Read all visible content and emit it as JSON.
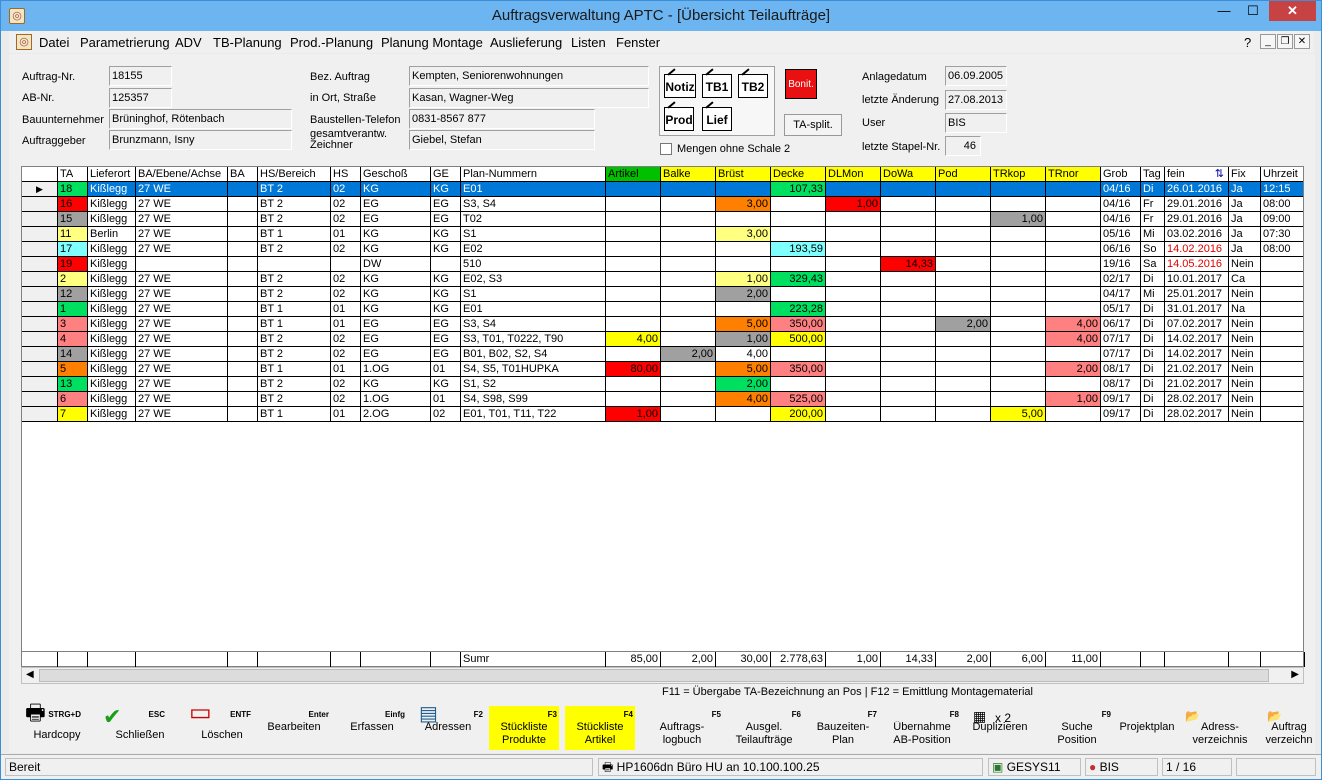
{
  "window": {
    "title": "Auftragsverwaltung APTC - [Übersicht Teilaufträge]"
  },
  "menu": [
    "Datei",
    "Parametrierung",
    "ADV",
    "TB-Planung",
    "Prod.-Planung",
    "Planung Montage",
    "Auslieferung",
    "Listen",
    "Fenster"
  ],
  "menu_help": "?",
  "form": {
    "auftrag_nr_label": "Auftrag-Nr.",
    "auftrag_nr": "18155",
    "ab_nr_label": "AB-Nr.",
    "ab_nr": "125357",
    "bauunternehmer_label": "Bauunternehmer",
    "bauunternehmer": "Brüninghof, Rötenbach",
    "auftraggeber_label": "Auftraggeber",
    "auftraggeber": "Brunzmann, Isny",
    "bez_auftrag_label": "Bez. Auftrag",
    "bez_auftrag": "Kempten, Seniorenwohnungen",
    "ort_strasse_label": "in Ort, Straße",
    "ort_strasse": "Kasan, Wagner-Weg",
    "baustellen_tel_label": "Baustellen-Telefon",
    "baustellen_tel": "0831-8567 877",
    "zeichner_label": "gesamtverantw. Zeichner",
    "zeichner": "Giebel, Stefan",
    "anlagedatum_label": "Anlagedatum",
    "anlagedatum": "06.09.2005",
    "letzte_aenderung_label": "letzte Änderung",
    "letzte_aenderung": "27.08.2013",
    "user_label": "User",
    "user": "BIS",
    "stapel_label": "letzte Stapel-Nr.",
    "stapel": "46"
  },
  "doc_buttons": [
    "Notiz",
    "TB1",
    "TB2",
    "Prod",
    "Lief"
  ],
  "bonit_label": "Bonit.",
  "tasplit_label": "TA-split.",
  "mengen_label": "Mengen ohne Schale 2",
  "colors": {
    "yellow": "#ffff00",
    "orange": "#ff8000",
    "green": "#00e060",
    "cyan": "#80ffff",
    "red": "#ff0000",
    "gray": "#a0a0a0",
    "pink": "#ff8080",
    "lightyellow": "#ffff80",
    "select": "#0078d7"
  },
  "columns": [
    "TA",
    "Lieferort",
    "BA/Ebene/Achse",
    "BA",
    "HS/Bereich",
    "HS",
    "Geschoß",
    "GE",
    "Plan-Nummern",
    "Artikel",
    "Balke",
    "Brüst",
    "Decke",
    "DLMon",
    "DoWa",
    "Pod",
    "TRkop",
    "TRnor",
    "Grob",
    "Tag",
    "fein",
    "Fix",
    "Uhrzeit"
  ],
  "rows": [
    {
      "ta": "18",
      "lieferort": "Kißlegg",
      "ba_ebene": "27 WE",
      "ba": "",
      "hs_bereich": "BT 2",
      "hs": "02",
      "geschoss": "KG",
      "ge": "KG",
      "plan": "E01",
      "artikel": "",
      "balke": "",
      "bruest": "",
      "decke": "107,33",
      "dlmon": "",
      "dowa": "",
      "pod": "",
      "trkop": "",
      "trnor": "",
      "grob": "04/16",
      "tag": "Di",
      "fein": "26.01.2016",
      "fix": "Ja",
      "uhrzeit": "12:15",
      "tac": "green",
      "selected": true
    },
    {
      "ta": "16",
      "lieferort": "Kißlegg",
      "ba_ebene": "27 WE",
      "ba": "",
      "hs_bereich": "BT 2",
      "hs": "02",
      "geschoss": "EG",
      "ge": "EG",
      "plan": "S3, S4",
      "artikel": "",
      "balke": "",
      "bruest": "3,00",
      "decke": "",
      "dlmon": "1,00",
      "dowa": "",
      "pod": "",
      "trkop": "",
      "trnor": "",
      "grob": "04/16",
      "tag": "Fr",
      "fein": "29.01.2016",
      "fix": "Ja",
      "uhrzeit": "08:00",
      "tac": "red"
    },
    {
      "ta": "15",
      "lieferort": "Kißlegg",
      "ba_ebene": "27 WE",
      "ba": "",
      "hs_bereich": "BT 2",
      "hs": "02",
      "geschoss": "EG",
      "ge": "EG",
      "plan": "T02",
      "artikel": "",
      "balke": "",
      "bruest": "",
      "decke": "",
      "dlmon": "",
      "dowa": "",
      "pod": "",
      "trkop": "1,00",
      "trnor": "",
      "grob": "04/16",
      "tag": "Fr",
      "fein": "29.01.2016",
      "fix": "Ja",
      "uhrzeit": "09:00",
      "tac": "gray"
    },
    {
      "ta": "11",
      "lieferort": "Berlin",
      "ba_ebene": "27 WE",
      "ba": "",
      "hs_bereich": "BT 1",
      "hs": "01",
      "geschoss": "KG",
      "ge": "KG",
      "plan": "S1",
      "artikel": "",
      "balke": "",
      "bruest": "3,00",
      "decke": "",
      "dlmon": "",
      "dowa": "",
      "pod": "",
      "trkop": "",
      "trnor": "",
      "grob": "05/16",
      "tag": "Mi",
      "fein": "03.02.2016",
      "fix": "Ja",
      "uhrzeit": "07:30",
      "tac": "lightyellow"
    },
    {
      "ta": "17",
      "lieferort": "Kißlegg",
      "ba_ebene": "27 WE",
      "ba": "",
      "hs_bereich": "BT 2",
      "hs": "02",
      "geschoss": "KG",
      "ge": "KG",
      "plan": "E02",
      "artikel": "",
      "balke": "",
      "bruest": "",
      "decke": "193,59",
      "dlmon": "",
      "dowa": "",
      "pod": "",
      "trkop": "",
      "trnor": "",
      "grob": "06/16",
      "tag": "So",
      "fein": "14.02.2016",
      "fix": "Ja",
      "uhrzeit": "08:00",
      "tac": "cyan",
      "fein_red": true
    },
    {
      "ta": "19",
      "lieferort": "Kißlegg",
      "ba_ebene": "",
      "ba": "",
      "hs_bereich": "",
      "hs": "",
      "geschoss": "DW",
      "ge": "",
      "plan": "510",
      "artikel": "",
      "balke": "",
      "bruest": "",
      "decke": "",
      "dlmon": "",
      "dowa": "14,33",
      "pod": "",
      "trkop": "",
      "trnor": "",
      "grob": "19/16",
      "tag": "Sa",
      "fein": "14.05.2016",
      "fix": "Nein",
      "uhrzeit": "",
      "tac": "red",
      "fein_red": true
    },
    {
      "ta": "2",
      "lieferort": "Kißlegg",
      "ba_ebene": "27 WE",
      "ba": "",
      "hs_bereich": "BT 2",
      "hs": "02",
      "geschoss": "KG",
      "ge": "KG",
      "plan": "E02, S3",
      "artikel": "",
      "balke": "",
      "bruest": "1,00",
      "decke": "329,43",
      "dlmon": "",
      "dowa": "",
      "pod": "",
      "trkop": "",
      "trnor": "",
      "grob": "02/17",
      "tag": "Di",
      "fein": "10.01.2017",
      "fix": "Ca",
      "uhrzeit": "",
      "tac": "lightyellow"
    },
    {
      "ta": "12",
      "lieferort": "Kißlegg",
      "ba_ebene": "27 WE",
      "ba": "",
      "hs_bereich": "BT 2",
      "hs": "02",
      "geschoss": "KG",
      "ge": "KG",
      "plan": "S1",
      "artikel": "",
      "balke": "",
      "bruest": "2,00",
      "decke": "",
      "dlmon": "",
      "dowa": "",
      "pod": "",
      "trkop": "",
      "trnor": "",
      "grob": "04/17",
      "tag": "Mi",
      "fein": "25.01.2017",
      "fix": "Nein",
      "uhrzeit": "",
      "tac": "gray"
    },
    {
      "ta": "1",
      "lieferort": "Kißlegg",
      "ba_ebene": "27 WE",
      "ba": "",
      "hs_bereich": "BT 1",
      "hs": "01",
      "geschoss": "KG",
      "ge": "KG",
      "plan": "E01",
      "artikel": "",
      "balke": "",
      "bruest": "",
      "decke": "223,28",
      "dlmon": "",
      "dowa": "",
      "pod": "",
      "trkop": "",
      "trnor": "",
      "grob": "05/17",
      "tag": "Di",
      "fein": "31.01.2017",
      "fix": "Na",
      "uhrzeit": "",
      "tac": "green"
    },
    {
      "ta": "3",
      "lieferort": "Kißlegg",
      "ba_ebene": "27 WE",
      "ba": "",
      "hs_bereich": "BT 1",
      "hs": "01",
      "geschoss": "EG",
      "ge": "EG",
      "plan": "S3, S4",
      "artikel": "",
      "balke": "",
      "bruest": "5,00",
      "decke": "350,00",
      "dlmon": "",
      "dowa": "",
      "pod": "2,00",
      "trkop": "",
      "trnor": "4,00",
      "grob": "06/17",
      "tag": "Di",
      "fein": "07.02.2017",
      "fix": "Nein",
      "uhrzeit": "",
      "tac": "pink"
    },
    {
      "ta": "4",
      "lieferort": "Kißlegg",
      "ba_ebene": "27 WE",
      "ba": "",
      "hs_bereich": "BT 2",
      "hs": "02",
      "geschoss": "EG",
      "ge": "EG",
      "plan": "S3, T01, T0222, T90",
      "artikel": "4,00",
      "balke": "",
      "bruest": "1,00",
      "decke": "500,00",
      "dlmon": "",
      "dowa": "",
      "pod": "",
      "trkop": "",
      "trnor": "4,00",
      "grob": "07/17",
      "tag": "Di",
      "fein": "14.02.2017",
      "fix": "Nein",
      "uhrzeit": "",
      "tac": "pink"
    },
    {
      "ta": "14",
      "lieferort": "Kißlegg",
      "ba_ebene": "27 WE",
      "ba": "",
      "hs_bereich": "BT 2",
      "hs": "02",
      "geschoss": "EG",
      "ge": "EG",
      "plan": "B01, B02, S2, S4",
      "artikel": "",
      "balke": "2,00",
      "bruest": "4,00",
      "decke": "",
      "dlmon": "",
      "dowa": "",
      "pod": "",
      "trkop": "",
      "trnor": "",
      "grob": "07/17",
      "tag": "Di",
      "fein": "14.02.2017",
      "fix": "Nein",
      "uhrzeit": "",
      "tac": "gray"
    },
    {
      "ta": "5",
      "lieferort": "Kißlegg",
      "ba_ebene": "27 WE",
      "ba": "",
      "hs_bereich": "BT 1",
      "hs": "01",
      "geschoss": "1.OG",
      "ge": "01",
      "plan": "S4, S5, T01HUPKA",
      "artikel": "80,00",
      "balke": "",
      "bruest": "5,00",
      "decke": "350,00",
      "dlmon": "",
      "dowa": "",
      "pod": "",
      "trkop": "",
      "trnor": "2,00",
      "grob": "08/17",
      "tag": "Di",
      "fein": "21.02.2017",
      "fix": "Nein",
      "uhrzeit": "",
      "tac": "orange"
    },
    {
      "ta": "13",
      "lieferort": "Kißlegg",
      "ba_ebene": "27 WE",
      "ba": "",
      "hs_bereich": "BT 2",
      "hs": "02",
      "geschoss": "KG",
      "ge": "KG",
      "plan": "S1, S2",
      "artikel": "",
      "balke": "",
      "bruest": "2,00",
      "decke": "",
      "dlmon": "",
      "dowa": "",
      "pod": "",
      "trkop": "",
      "trnor": "",
      "grob": "08/17",
      "tag": "Di",
      "fein": "21.02.2017",
      "fix": "Nein",
      "uhrzeit": "",
      "tac": "green"
    },
    {
      "ta": "6",
      "lieferort": "Kißlegg",
      "ba_ebene": "27 WE",
      "ba": "",
      "hs_bereich": "BT 2",
      "hs": "02",
      "geschoss": "1.OG",
      "ge": "01",
      "plan": "S4, S98, S99",
      "artikel": "",
      "balke": "",
      "bruest": "4,00",
      "decke": "525,00",
      "dlmon": "",
      "dowa": "",
      "pod": "",
      "trkop": "",
      "trnor": "1,00",
      "grob": "09/17",
      "tag": "Di",
      "fein": "28.02.2017",
      "fix": "Nein",
      "uhrzeit": "",
      "tac": "pink"
    },
    {
      "ta": "7",
      "lieferort": "Kißlegg",
      "ba_ebene": "27 WE",
      "ba": "",
      "hs_bereich": "BT 1",
      "hs": "01",
      "geschoss": "2.OG",
      "ge": "02",
      "plan": "E01, T01, T11, T22",
      "artikel": "1,00",
      "balke": "",
      "bruest": "",
      "decke": "200,00",
      "dlmon": "",
      "dowa": "",
      "pod": "",
      "trkop": "5,00",
      "trnor": "",
      "grob": "09/17",
      "tag": "Di",
      "fein": "28.02.2017",
      "fix": "Nein",
      "uhrzeit": "",
      "tac": "yellow"
    }
  ],
  "cell_colors": {
    "artikel": [
      "",
      "",
      "",
      "",
      "",
      "",
      "",
      "",
      "",
      "",
      "yellow",
      "",
      "red",
      "",
      "",
      "red"
    ],
    "balke": [
      "",
      "",
      "",
      "",
      "",
      "",
      "",
      "",
      "",
      "",
      "",
      "gray",
      "",
      "",
      "",
      ""
    ],
    "bruest": [
      "",
      "orange",
      "",
      "lightyellow",
      "",
      "",
      "lightyellow",
      "gray",
      "",
      "orange",
      "gray",
      "",
      "orange",
      "green",
      "orange",
      ""
    ],
    "decke": [
      "green",
      "",
      "",
      "",
      "cyan",
      "",
      "green",
      "",
      "green",
      "pink",
      "yellow",
      "",
      "pink",
      "",
      "pink",
      "yellow"
    ],
    "dlmon": [
      "",
      "red",
      "",
      "",
      "",
      "",
      "",
      "",
      "",
      "",
      "",
      "",
      "",
      "",
      "",
      ""
    ],
    "dowa": [
      "",
      "",
      "",
      "",
      "",
      "red",
      "",
      "",
      "",
      "",
      "",
      "",
      "",
      "",
      "",
      ""
    ],
    "pod": [
      "",
      "",
      "",
      "",
      "",
      "",
      "",
      "",
      "",
      "gray",
      "",
      "",
      "",
      "",
      "",
      ""
    ],
    "trkop": [
      "",
      "",
      "gray",
      "",
      "",
      "",
      "",
      "",
      "",
      "",
      "",
      "",
      "",
      "",
      "",
      "yellow"
    ],
    "trnor": [
      "",
      "",
      "",
      "",
      "",
      "",
      "",
      "",
      "",
      "pink",
      "pink",
      "",
      "pink",
      "",
      "pink",
      ""
    ]
  },
  "sums": {
    "label": "Sumr",
    "artikel": "85,00",
    "balke": "2,00",
    "bruest": "30,00",
    "decke": "2.778,63",
    "dlmon": "1,00",
    "dowa": "14,33",
    "pod": "2,00",
    "trkop": "6,00",
    "trnor": "11,00"
  },
  "hint": "F11 = Übergabe TA-Bezeichnung an Pos | F12 = Emittlung Montagematerial",
  "toolbar": [
    {
      "label": "Hardcopy",
      "key": "STRG+D",
      "icon": "printer-icon"
    },
    {
      "label": "Schließen",
      "key": "ESC",
      "icon": "checkmark-icon"
    },
    {
      "label": "Löschen",
      "key": "ENTF",
      "icon": "delete-icon"
    },
    {
      "label": "Bearbeiten",
      "key": "Enter",
      "icon": ""
    },
    {
      "label": "Erfassen",
      "key": "Einfg",
      "icon": ""
    },
    {
      "label": "Adressen",
      "key": "F2",
      "icon": "address-book-icon"
    },
    {
      "label": "Stückliste Produkte",
      "key": "F3",
      "icon": "",
      "highlight": true
    },
    {
      "label": "Stückliste Artikel",
      "key": "F4",
      "icon": "",
      "highlight": true
    },
    {
      "label": "Auftrags-logbuch",
      "key": "F5",
      "icon": ""
    },
    {
      "label": "Ausgel. Teilaufträge",
      "key": "F6",
      "icon": ""
    },
    {
      "label": "Bauzeiten-Plan",
      "key": "F7",
      "icon": ""
    },
    {
      "label": "Übernahme AB-Position",
      "key": "F8",
      "icon": ""
    },
    {
      "label": "Duplizieren",
      "key": "",
      "icon": "duplicate-icon",
      "extra": "x 2"
    },
    {
      "label": "Suche Position",
      "key": "F9",
      "icon": ""
    },
    {
      "label": "Projektplan",
      "key": "",
      "icon": ""
    },
    {
      "label": "Adress-verzeichnis",
      "key": "",
      "icon": "folder-icon"
    },
    {
      "label": "Auftrag verzeichn",
      "key": "",
      "icon": "folder-icon"
    }
  ],
  "status": {
    "ready": "Bereit",
    "printer": "HP1606dn Büro HU an 10.100.100.25",
    "server": "GESYS11",
    "user": "BIS",
    "record": "1 / 16"
  }
}
